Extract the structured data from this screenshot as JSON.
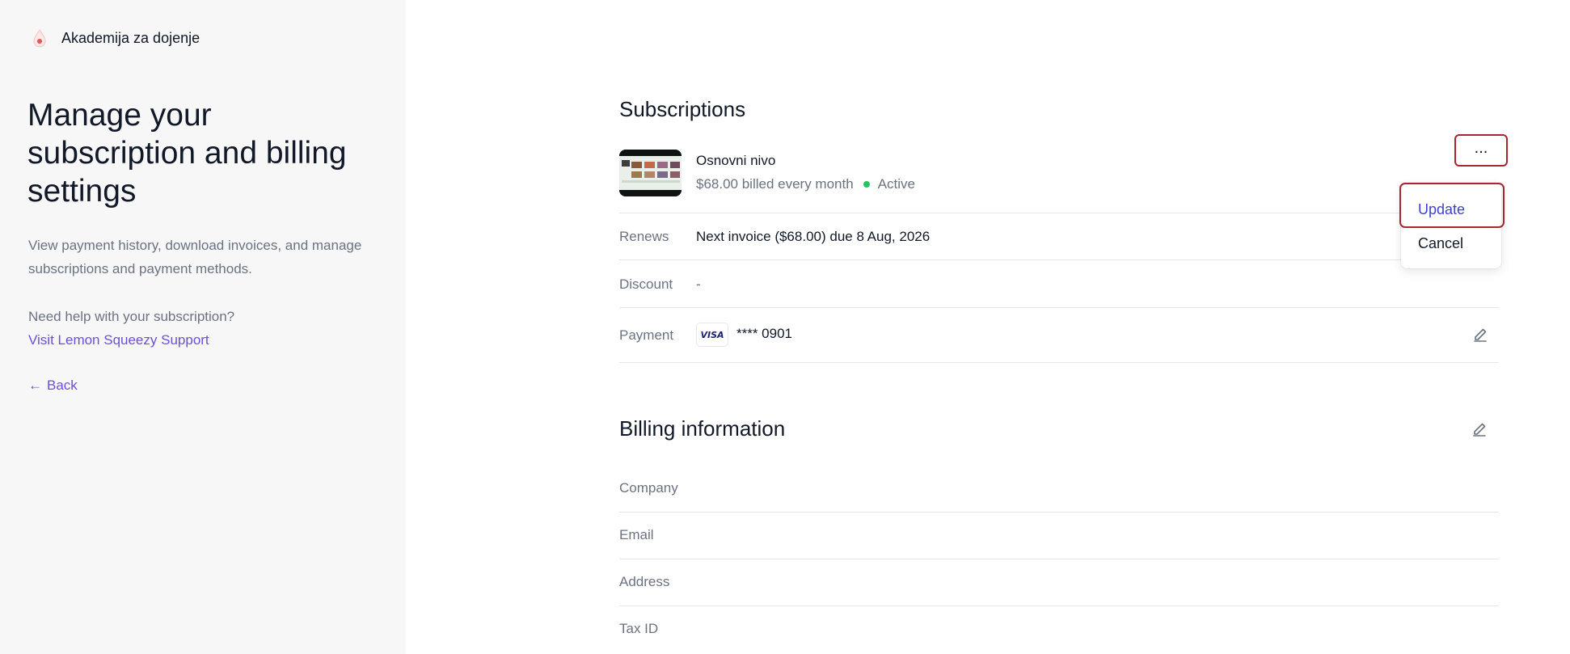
{
  "brand": {
    "name": "Akademija za dojenje",
    "logo_icon": "drop-logo-icon"
  },
  "sidebar": {
    "headline": "Manage your subscription and billing settings",
    "description": "View payment history, download invoices, and manage subscriptions and payment methods.",
    "help_text": "Need help with your subscription?",
    "help_link": "Visit Lemon Squeezy Support",
    "back_arrow": "←",
    "back_label": "Back"
  },
  "subscriptions": {
    "title": "Subscriptions",
    "plan": {
      "name": "Osnovni nivo",
      "billing": "$68.00 billed every month",
      "status": "Active"
    },
    "rows": [
      {
        "label": "Renews",
        "value": "Next invoice ($68.00) due 8 Aug, 2026"
      },
      {
        "label": "Discount",
        "value": "-"
      },
      {
        "label": "Payment",
        "value": "**** 0901",
        "card_brand": "VISA"
      }
    ],
    "more_button": "...",
    "menu": {
      "update": "Update",
      "cancel": "Cancel"
    }
  },
  "billing": {
    "title": "Billing information",
    "fields": [
      "Company",
      "Email",
      "Address",
      "Tax ID"
    ]
  },
  "colors": {
    "accent": "#6d4fd8",
    "status_active": "#22c55e",
    "highlight": "#a5282e",
    "sidebar_bg": "#f7f7f8"
  }
}
